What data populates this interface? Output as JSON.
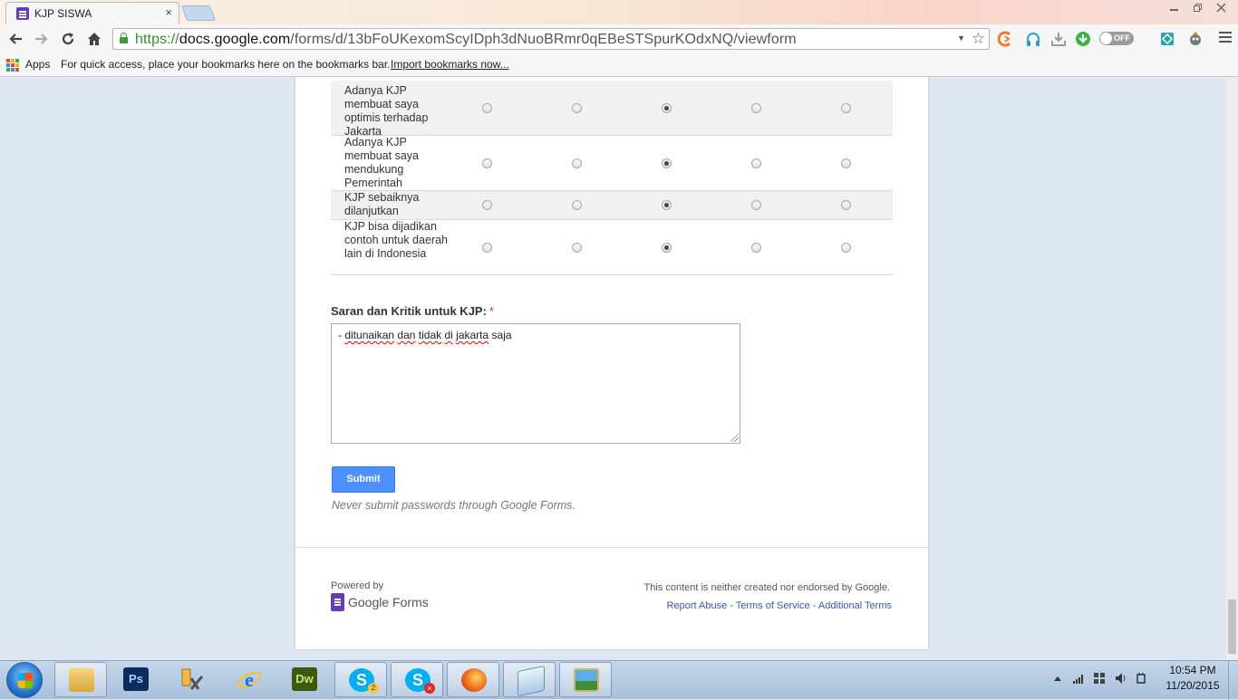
{
  "browser": {
    "tab_title": "KJP SISWA",
    "tab_close": "×",
    "url_scheme": "https://",
    "url_host": "docs.google.com",
    "url_path": "/forms/d/13bFoUKexomScyIDph3dNuoBRmr0qEBeSTSpurKOdxNQ/viewform",
    "toggle_label": "OFF",
    "apps_label": "Apps",
    "bookmarks_message": "For quick access, place your bookmarks here on the bookmarks bar.",
    "import_link": "Import bookmarks now..."
  },
  "form": {
    "grid_rows": [
      {
        "label": "Adanya KJP membuat saya optimis terhadap Jakarta",
        "selected_column": 2
      },
      {
        "label": "Adanya KJP membuat saya mendukung Pemerintah",
        "selected_column": 2
      },
      {
        "label": "KJP sebaiknya dilanjutkan",
        "selected_column": 2
      },
      {
        "label": "KJP bisa dijadikan contoh untuk daerah lain di Indonesia",
        "selected_column": 2
      }
    ],
    "question_label": "Saran dan Kritik untuk KJP:",
    "required_mark": "*",
    "answer_parts": [
      "- ",
      "ditunaikan",
      " ",
      "dan",
      " ",
      "tidak",
      " ",
      "di",
      " ",
      "jakarta",
      " saja"
    ],
    "submit_label": "Submit",
    "warning": "Never submit passwords through Google Forms.",
    "powered_by": "Powered by",
    "brand_name": "Google Forms",
    "disclaimer": "This content is neither created nor endorsed by Google.",
    "footer_links": [
      "Report Abuse",
      "Terms of Service",
      "Additional Terms"
    ],
    "footer_separator": " - "
  },
  "taskbar": {
    "items": [
      {
        "name": "file-explorer",
        "active": true
      },
      {
        "name": "photoshop",
        "label": "Ps"
      },
      {
        "name": "tools"
      },
      {
        "name": "internet-explorer"
      },
      {
        "name": "dreamweaver",
        "label": "Dw"
      },
      {
        "name": "skype",
        "active": true,
        "badge": "2"
      },
      {
        "name": "skype-offline",
        "active": true
      },
      {
        "name": "firefox",
        "active": true
      },
      {
        "name": "notepad",
        "active": true
      },
      {
        "name": "photo-viewer",
        "active": true
      }
    ],
    "time": "10:54 PM",
    "date": "11/20/2015"
  },
  "colors": {
    "accent_blue": "#4d90fe",
    "forms_purple": "#673ab7",
    "required_red": "#c43b1d",
    "link_blue": "#3f56a6"
  }
}
